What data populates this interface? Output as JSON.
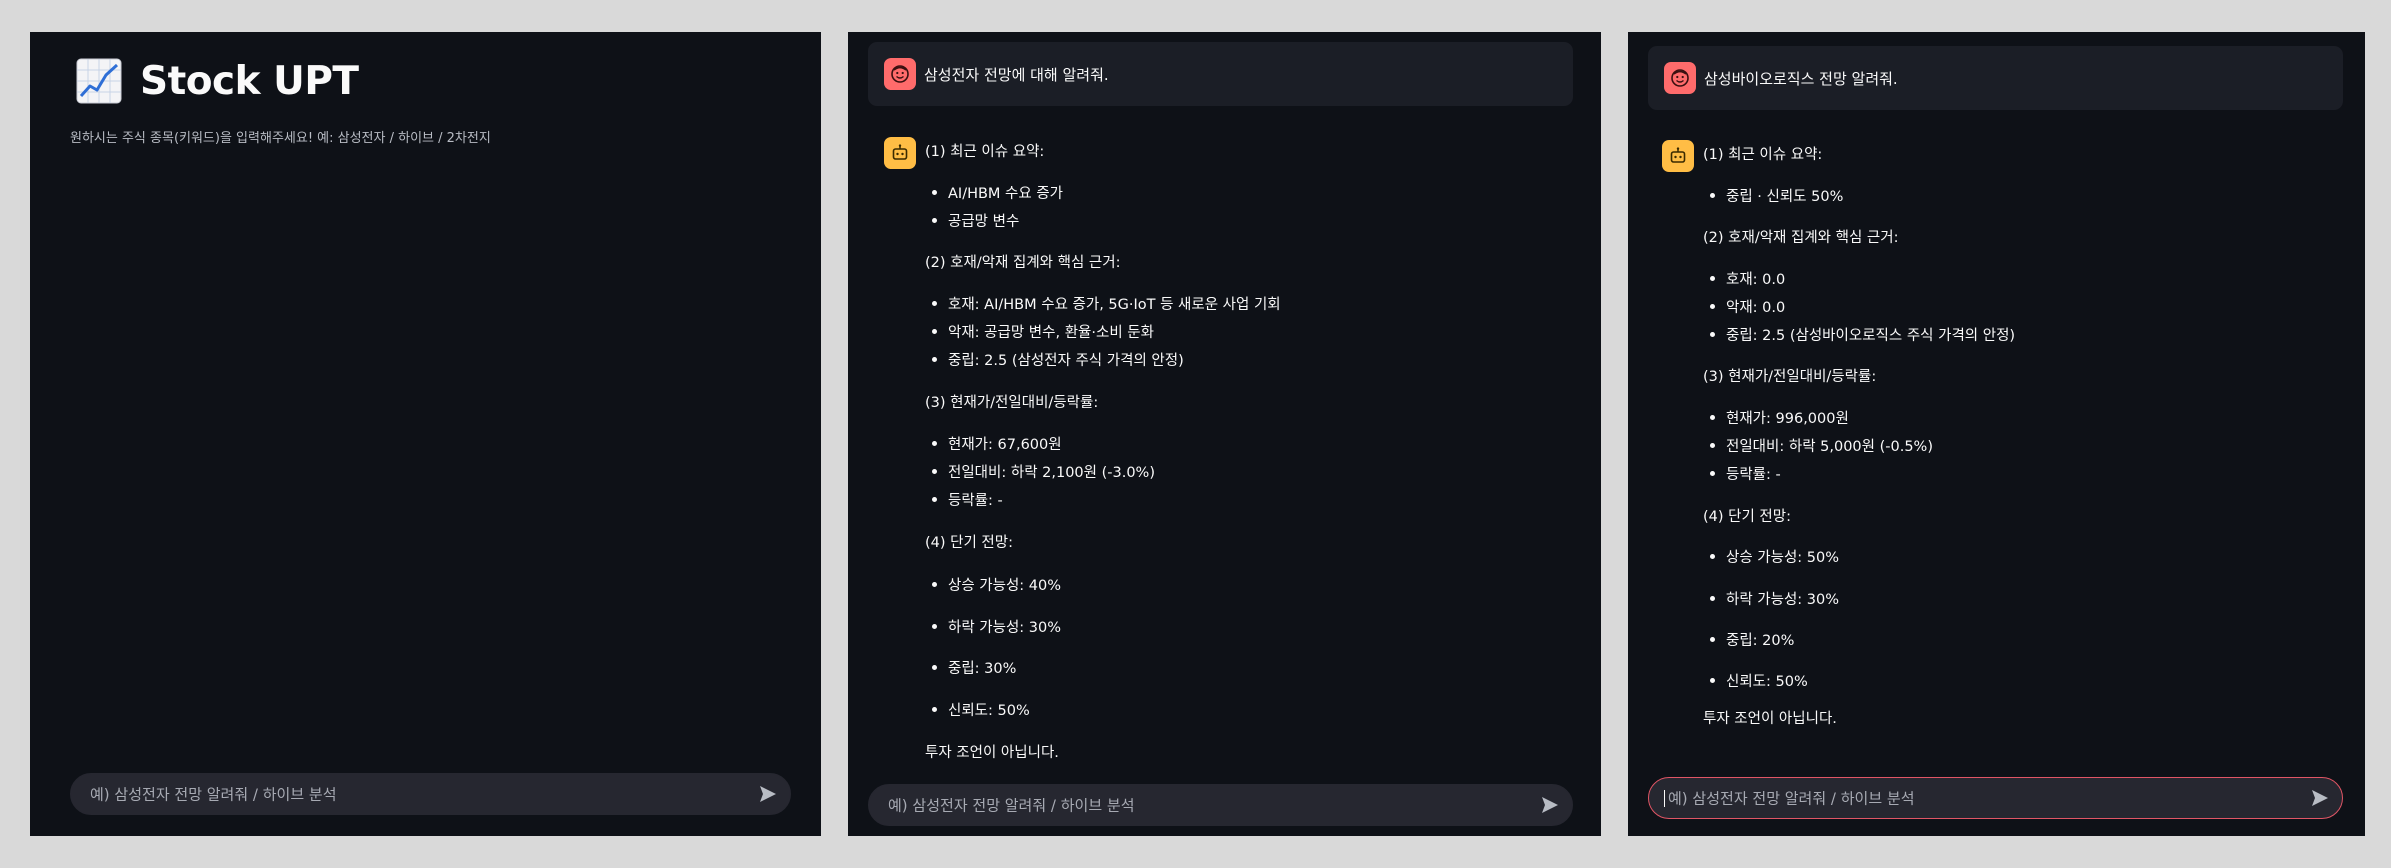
{
  "panel1": {
    "app_title": "Stock UPT",
    "subtitle": "원하시는 주식 종목(키워드)을 입력해주세요! 예: 삼성전자 / 하이브 / 2차전지",
    "input_placeholder": "예) 삼성전자 전망 알려줘 / 하이브 분석"
  },
  "panel2": {
    "user_message": "삼성전자 전망에 대해 알려줘.",
    "assistant": {
      "s1_heading": "(1) 최근 이슈 요약:",
      "s1_items": [
        "AI/HBM 수요 증가",
        "공급망 변수"
      ],
      "s2_heading": "(2) 호재/악재 집계와 핵심 근거:",
      "s2_items": [
        "호재: AI/HBM 수요 증가, 5G·IoT 등 새로운 사업 기회",
        "악재: 공급망 변수, 환율·소비 둔화",
        "중립: 2.5 (삼성전자 주식 가격의 안정)"
      ],
      "s3_heading": "(3) 현재가/전일대비/등락률:",
      "s3_items": [
        "현재가: 67,600원",
        "전일대비: 하락 2,100원 (-3.0%)",
        "등락률: -"
      ],
      "s4_heading": "(4) 단기 전망:",
      "s4_items": [
        "상승 가능성: 40%",
        "하락 가능성: 30%",
        "중립: 30%",
        "신뢰도: 50%"
      ],
      "disclaimer": "투자 조언이 아닙니다."
    },
    "input_placeholder": "예) 삼성전자 전망 알려줘 / 하이브 분석"
  },
  "panel3": {
    "user_message": "삼성바이오로직스 전망 알려줘.",
    "assistant": {
      "s1_heading": "(1) 최근 이슈 요약:",
      "s1_items": [
        "중립 · 신뢰도 50%"
      ],
      "s2_heading": "(2) 호재/악재 집계와 핵심 근거:",
      "s2_items": [
        "호재: 0.0",
        "악재: 0.0",
        "중립: 2.5 (삼성바이오로직스 주식 가격의 안정)"
      ],
      "s3_heading": "(3) 현재가/전일대비/등락률:",
      "s3_items": [
        "현재가: 996,000원",
        "전일대비: 하락 5,000원 (-0.5%)",
        "등락률: -"
      ],
      "s4_heading": "(4) 단기 전망:",
      "s4_items": [
        "상승 가능성: 50%",
        "하락 가능성: 30%",
        "중립: 20%",
        "신뢰도: 50%"
      ],
      "disclaimer": "투자 조언이 아닙니다."
    },
    "input_placeholder": "예) 삼성전자 전망 알려줘 / 하이브 분석"
  },
  "icons": {
    "title": "chart-increasing-icon",
    "user_avatar": "user-face-icon",
    "bot_avatar": "robot-icon",
    "send": "send-arrow-icon"
  },
  "colors": {
    "background": "#0e1117",
    "user_avatar": "#ff6b6b",
    "bot_avatar": "#ffbd45",
    "input_focus_border": "#e05565"
  }
}
